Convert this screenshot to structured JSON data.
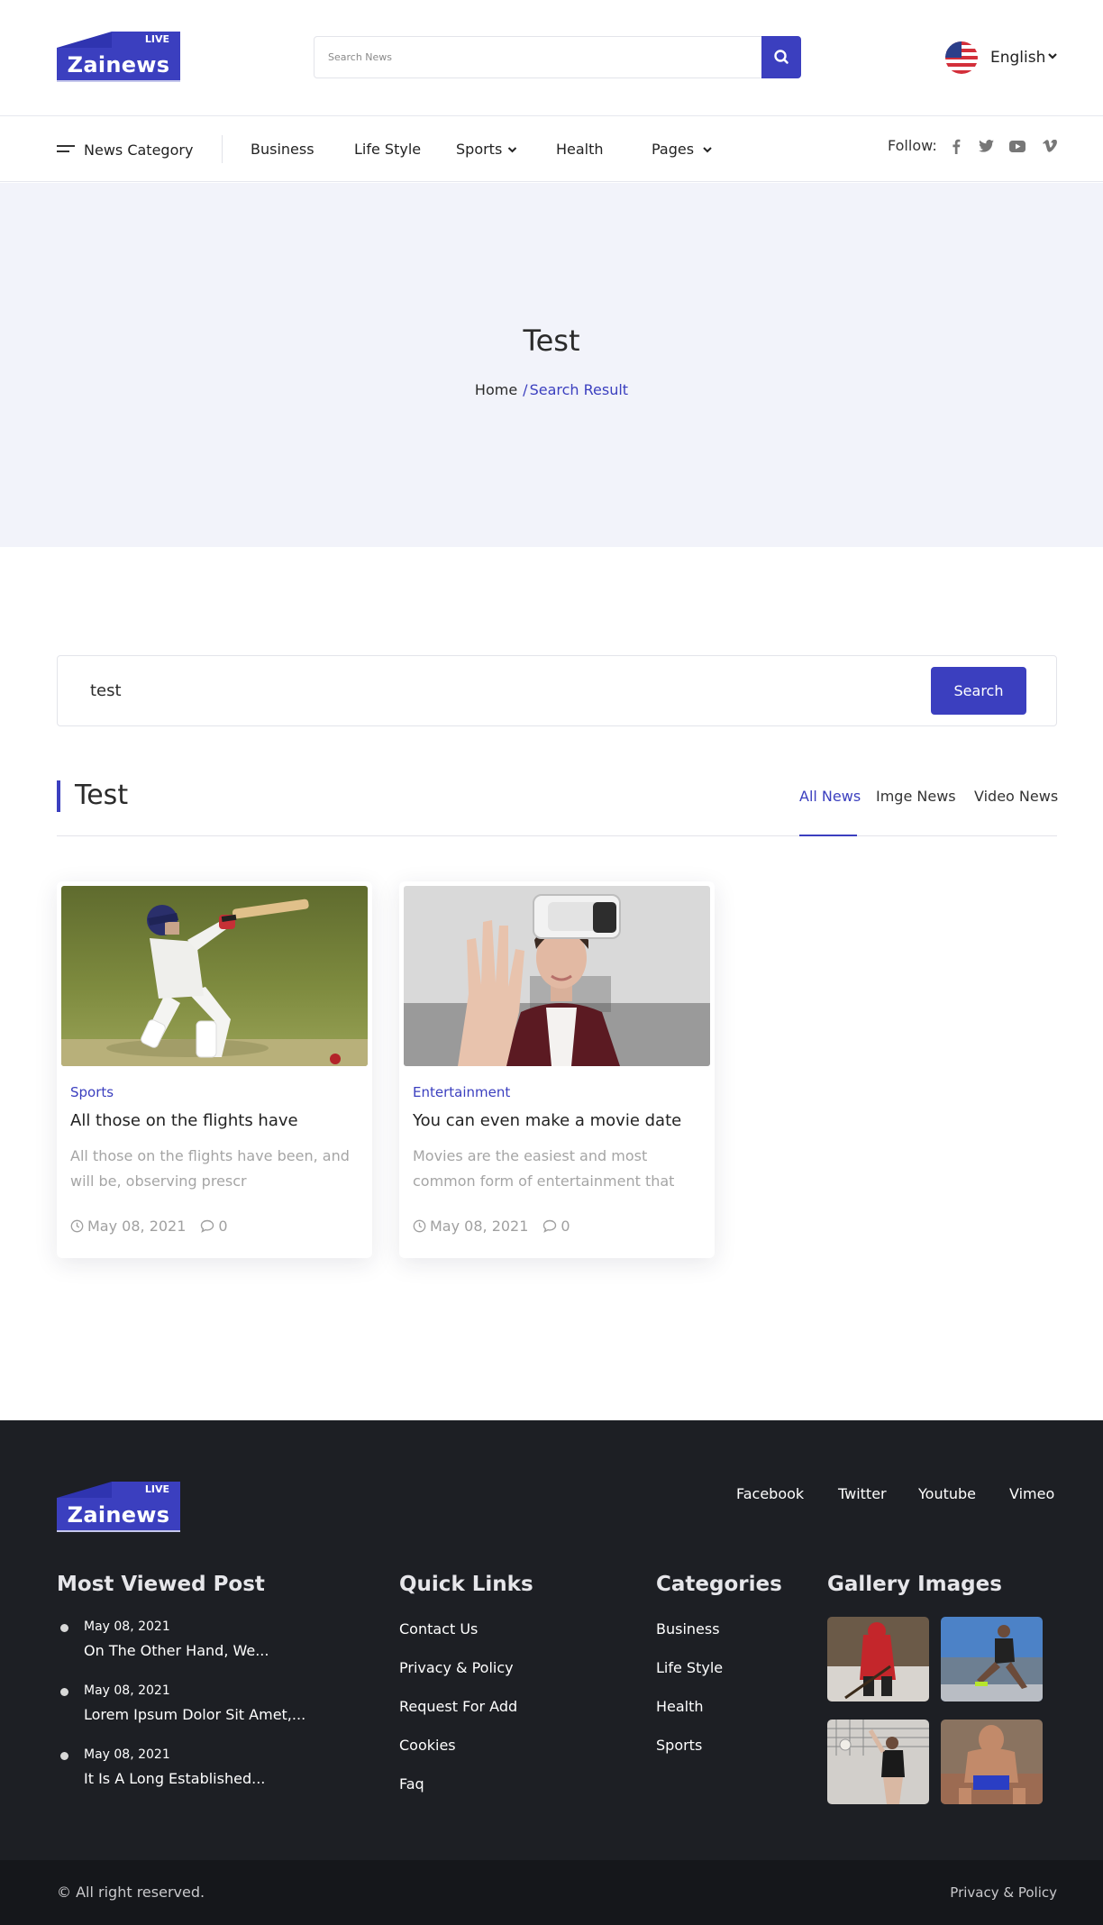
{
  "header": {
    "logo": {
      "live": "LIVE",
      "name": "Zainews"
    },
    "search_placeholder": "Search News",
    "language": "English"
  },
  "nav": {
    "category_label": "News Category",
    "items": [
      {
        "label": "Business"
      },
      {
        "label": "Life Style"
      },
      {
        "label": "Sports"
      },
      {
        "label": "Health"
      },
      {
        "label": "Pages"
      }
    ],
    "follow_label": "Follow:",
    "social": [
      "facebook-icon",
      "twitter-icon",
      "youtube-icon",
      "vimeo-icon"
    ]
  },
  "hero": {
    "title": "Test",
    "breadcrumb": {
      "home": "Home",
      "separator": "/",
      "current": "Search Result"
    }
  },
  "search": {
    "value": "test",
    "button": "Search"
  },
  "section": {
    "title": "Test",
    "tabs": [
      {
        "label": "All News",
        "active": true
      },
      {
        "label": "Imge News",
        "active": false
      },
      {
        "label": "Video News",
        "active": false
      }
    ]
  },
  "cards": [
    {
      "category": "Sports",
      "title": "All those on the flights have",
      "excerpt": "All those on the flights have been, and will be, observing prescr",
      "date": "May 08, 2021",
      "comments": "0"
    },
    {
      "category": "Entertainment",
      "title": "You can even make a movie date",
      "excerpt": "Movies are the easiest and most common form of entertainment that",
      "date": "May 08, 2021",
      "comments": "0"
    }
  ],
  "footer": {
    "logo": {
      "live": "LIVE",
      "name": "Zainews"
    },
    "social_links": [
      "Facebook",
      "Twitter",
      "Youtube",
      "Vimeo"
    ],
    "most_viewed": {
      "title": "Most Viewed Post",
      "posts": [
        {
          "date": "May 08, 2021",
          "title": "On The Other Hand, We..."
        },
        {
          "date": "May 08, 2021",
          "title": "Lorem Ipsum Dolor Sit Amet,..."
        },
        {
          "date": "May 08, 2021",
          "title": "It Is A Long Established..."
        }
      ]
    },
    "quick_links": {
      "title": "Quick Links",
      "items": [
        "Contact Us",
        "Privacy & Policy",
        "Request For Add",
        "Cookies",
        "Faq"
      ]
    },
    "categories": {
      "title": "Categories",
      "items": [
        "Business",
        "Life Style",
        "Health",
        "Sports"
      ]
    },
    "gallery": {
      "title": "Gallery Images"
    },
    "copyright": "© All right reserved.",
    "privacy": "Privacy & Policy"
  },
  "colors": {
    "accent": "#3b3fbf",
    "hero_bg": "#f2f3fa",
    "footer_bg": "#1d1f24",
    "copyright_bg": "#15171b"
  }
}
